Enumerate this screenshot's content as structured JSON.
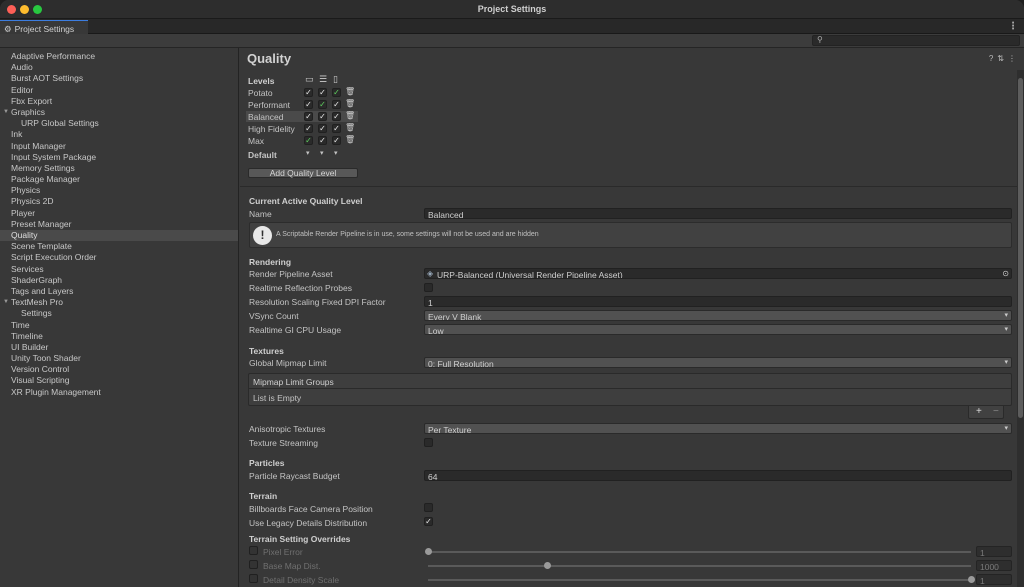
{
  "window": {
    "title": "Project Settings"
  },
  "tab": {
    "label": "Project Settings",
    "icon": "gear-icon"
  },
  "sidebar": {
    "items": [
      {
        "label": "Adaptive Performance"
      },
      {
        "label": "Audio"
      },
      {
        "label": "Burst AOT Settings"
      },
      {
        "label": "Editor"
      },
      {
        "label": "Fbx Export"
      },
      {
        "label": "Graphics",
        "expanded": true
      },
      {
        "label": "URP Global Settings",
        "sub": true
      },
      {
        "label": "Ink"
      },
      {
        "label": "Input Manager"
      },
      {
        "label": "Input System Package"
      },
      {
        "label": "Memory Settings"
      },
      {
        "label": "Package Manager"
      },
      {
        "label": "Physics"
      },
      {
        "label": "Physics 2D"
      },
      {
        "label": "Player"
      },
      {
        "label": "Preset Manager"
      },
      {
        "label": "Quality",
        "selected": true
      },
      {
        "label": "Scene Template"
      },
      {
        "label": "Script Execution Order"
      },
      {
        "label": "Services"
      },
      {
        "label": "ShaderGraph"
      },
      {
        "label": "Tags and Layers"
      },
      {
        "label": "TextMesh Pro",
        "expanded": true
      },
      {
        "label": "Settings",
        "sub": true
      },
      {
        "label": "Time"
      },
      {
        "label": "Timeline"
      },
      {
        "label": "UI Builder"
      },
      {
        "label": "Unity Toon Shader"
      },
      {
        "label": "Version Control"
      },
      {
        "label": "Visual Scripting"
      },
      {
        "label": "XR Plugin Management"
      }
    ]
  },
  "quality": {
    "title": "Quality",
    "levels_label": "Levels",
    "default_label": "Default",
    "add_button": "Add Quality Level",
    "levels": [
      {
        "name": "Potato",
        "checks": [
          "on",
          "on",
          "green"
        ]
      },
      {
        "name": "Performant",
        "checks": [
          "on",
          "green",
          "on"
        ]
      },
      {
        "name": "Balanced",
        "checks": [
          "on",
          "on",
          "on"
        ],
        "selected": true
      },
      {
        "name": "High Fidelity",
        "checks": [
          "on",
          "on",
          "on"
        ]
      },
      {
        "name": "Max",
        "checks": [
          "green",
          "on",
          "on"
        ]
      }
    ]
  },
  "active": {
    "heading": "Current Active Quality Level",
    "name_label": "Name",
    "name_value": "Balanced",
    "help_text": "A Scriptable Render Pipeline is in use, some settings will not be used and are hidden"
  },
  "rendering": {
    "heading": "Rendering",
    "pipeline_label": "Render Pipeline Asset",
    "pipeline_value": "URP-Balanced (Universal Render Pipeline Asset)",
    "reflection_label": "Realtime Reflection Probes",
    "dpi_label": "Resolution Scaling Fixed DPI Factor",
    "dpi_value": "1",
    "vsync_label": "VSync Count",
    "vsync_value": "Every V Blank",
    "gi_label": "Realtime GI CPU Usage",
    "gi_value": "Low"
  },
  "textures": {
    "heading": "Textures",
    "mipmap_label": "Global Mipmap Limit",
    "mipmap_value": "0: Full Resolution",
    "groups_label": "Mipmap Limit Groups",
    "groups_empty": "List is Empty",
    "aniso_label": "Anisotropic Textures",
    "aniso_value": "Per Texture",
    "streaming_label": "Texture Streaming"
  },
  "particles": {
    "heading": "Particles",
    "raycast_label": "Particle Raycast Budget",
    "raycast_value": "64"
  },
  "terrain": {
    "heading": "Terrain",
    "billboards_label": "Billboards Face Camera Position",
    "legacy_label": "Use Legacy Details Distribution"
  },
  "overrides": {
    "heading": "Terrain Setting Overrides",
    "pixel_error_label": "Pixel Error",
    "pixel_error_value": "1",
    "pixel_error_level": 0.0,
    "basemap_label": "Base Map Dist.",
    "basemap_value": "1000",
    "basemap_level": 0.22,
    "density_label": "Detail Density Scale",
    "density_value": "1",
    "density_level": 1.0
  }
}
